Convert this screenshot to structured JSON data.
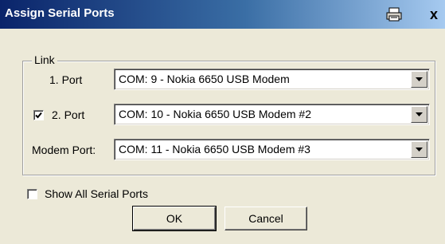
{
  "window": {
    "title": "Assign Serial Ports",
    "close_label": "x"
  },
  "link_group": {
    "label": "Link",
    "port1": {
      "label": "1. Port",
      "value": "COM: 9 - Nokia 6650 USB Modem"
    },
    "port2": {
      "label": "2. Port",
      "checked": true,
      "value": "COM: 10 - Nokia 6650 USB Modem #2"
    },
    "modem_port": {
      "label": "Modem Port:",
      "value": "COM: 11 - Nokia 6650 USB Modem #3"
    }
  },
  "show_all": {
    "label": "Show All Serial Ports",
    "checked": false
  },
  "buttons": {
    "ok": "OK",
    "cancel": "Cancel"
  },
  "colors": {
    "title_start": "#0a246a",
    "title_end": "#a6caf0",
    "dialog_bg": "#ece9d8"
  }
}
